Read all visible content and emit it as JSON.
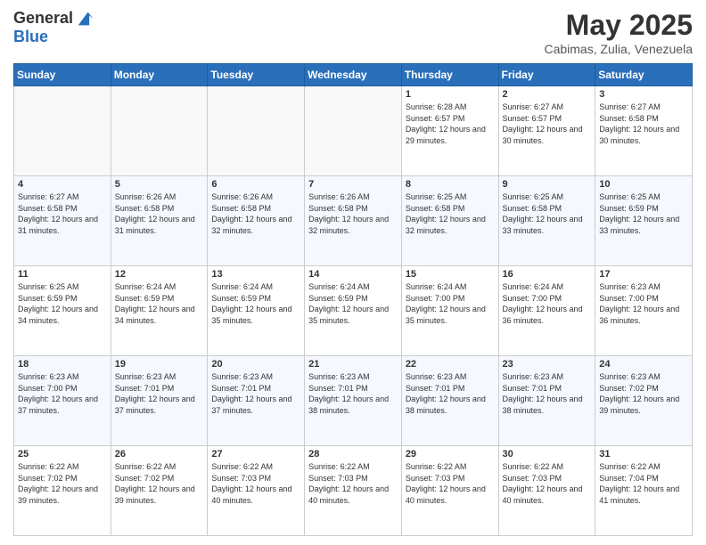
{
  "logo": {
    "general": "General",
    "blue": "Blue"
  },
  "title": "May 2025",
  "subtitle": "Cabimas, Zulia, Venezuela",
  "days_of_week": [
    "Sunday",
    "Monday",
    "Tuesday",
    "Wednesday",
    "Thursday",
    "Friday",
    "Saturday"
  ],
  "weeks": [
    [
      {
        "day": "",
        "info": ""
      },
      {
        "day": "",
        "info": ""
      },
      {
        "day": "",
        "info": ""
      },
      {
        "day": "",
        "info": ""
      },
      {
        "day": "1",
        "info": "Sunrise: 6:28 AM\nSunset: 6:57 PM\nDaylight: 12 hours and 29 minutes."
      },
      {
        "day": "2",
        "info": "Sunrise: 6:27 AM\nSunset: 6:57 PM\nDaylight: 12 hours and 30 minutes."
      },
      {
        "day": "3",
        "info": "Sunrise: 6:27 AM\nSunset: 6:58 PM\nDaylight: 12 hours and 30 minutes."
      }
    ],
    [
      {
        "day": "4",
        "info": "Sunrise: 6:27 AM\nSunset: 6:58 PM\nDaylight: 12 hours and 31 minutes."
      },
      {
        "day": "5",
        "info": "Sunrise: 6:26 AM\nSunset: 6:58 PM\nDaylight: 12 hours and 31 minutes."
      },
      {
        "day": "6",
        "info": "Sunrise: 6:26 AM\nSunset: 6:58 PM\nDaylight: 12 hours and 32 minutes."
      },
      {
        "day": "7",
        "info": "Sunrise: 6:26 AM\nSunset: 6:58 PM\nDaylight: 12 hours and 32 minutes."
      },
      {
        "day": "8",
        "info": "Sunrise: 6:25 AM\nSunset: 6:58 PM\nDaylight: 12 hours and 32 minutes."
      },
      {
        "day": "9",
        "info": "Sunrise: 6:25 AM\nSunset: 6:58 PM\nDaylight: 12 hours and 33 minutes."
      },
      {
        "day": "10",
        "info": "Sunrise: 6:25 AM\nSunset: 6:59 PM\nDaylight: 12 hours and 33 minutes."
      }
    ],
    [
      {
        "day": "11",
        "info": "Sunrise: 6:25 AM\nSunset: 6:59 PM\nDaylight: 12 hours and 34 minutes."
      },
      {
        "day": "12",
        "info": "Sunrise: 6:24 AM\nSunset: 6:59 PM\nDaylight: 12 hours and 34 minutes."
      },
      {
        "day": "13",
        "info": "Sunrise: 6:24 AM\nSunset: 6:59 PM\nDaylight: 12 hours and 35 minutes."
      },
      {
        "day": "14",
        "info": "Sunrise: 6:24 AM\nSunset: 6:59 PM\nDaylight: 12 hours and 35 minutes."
      },
      {
        "day": "15",
        "info": "Sunrise: 6:24 AM\nSunset: 7:00 PM\nDaylight: 12 hours and 35 minutes."
      },
      {
        "day": "16",
        "info": "Sunrise: 6:24 AM\nSunset: 7:00 PM\nDaylight: 12 hours and 36 minutes."
      },
      {
        "day": "17",
        "info": "Sunrise: 6:23 AM\nSunset: 7:00 PM\nDaylight: 12 hours and 36 minutes."
      }
    ],
    [
      {
        "day": "18",
        "info": "Sunrise: 6:23 AM\nSunset: 7:00 PM\nDaylight: 12 hours and 37 minutes."
      },
      {
        "day": "19",
        "info": "Sunrise: 6:23 AM\nSunset: 7:01 PM\nDaylight: 12 hours and 37 minutes."
      },
      {
        "day": "20",
        "info": "Sunrise: 6:23 AM\nSunset: 7:01 PM\nDaylight: 12 hours and 37 minutes."
      },
      {
        "day": "21",
        "info": "Sunrise: 6:23 AM\nSunset: 7:01 PM\nDaylight: 12 hours and 38 minutes."
      },
      {
        "day": "22",
        "info": "Sunrise: 6:23 AM\nSunset: 7:01 PM\nDaylight: 12 hours and 38 minutes."
      },
      {
        "day": "23",
        "info": "Sunrise: 6:23 AM\nSunset: 7:01 PM\nDaylight: 12 hours and 38 minutes."
      },
      {
        "day": "24",
        "info": "Sunrise: 6:23 AM\nSunset: 7:02 PM\nDaylight: 12 hours and 39 minutes."
      }
    ],
    [
      {
        "day": "25",
        "info": "Sunrise: 6:22 AM\nSunset: 7:02 PM\nDaylight: 12 hours and 39 minutes."
      },
      {
        "day": "26",
        "info": "Sunrise: 6:22 AM\nSunset: 7:02 PM\nDaylight: 12 hours and 39 minutes."
      },
      {
        "day": "27",
        "info": "Sunrise: 6:22 AM\nSunset: 7:03 PM\nDaylight: 12 hours and 40 minutes."
      },
      {
        "day": "28",
        "info": "Sunrise: 6:22 AM\nSunset: 7:03 PM\nDaylight: 12 hours and 40 minutes."
      },
      {
        "day": "29",
        "info": "Sunrise: 6:22 AM\nSunset: 7:03 PM\nDaylight: 12 hours and 40 minutes."
      },
      {
        "day": "30",
        "info": "Sunrise: 6:22 AM\nSunset: 7:03 PM\nDaylight: 12 hours and 40 minutes."
      },
      {
        "day": "31",
        "info": "Sunrise: 6:22 AM\nSunset: 7:04 PM\nDaylight: 12 hours and 41 minutes."
      }
    ]
  ]
}
